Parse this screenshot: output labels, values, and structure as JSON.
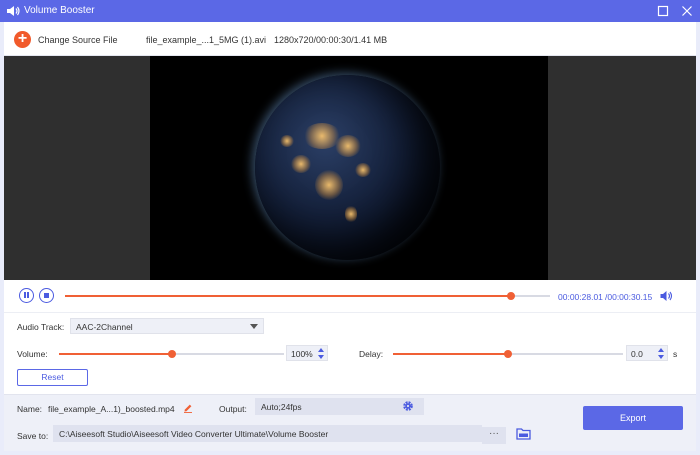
{
  "window": {
    "title": "Volume Booster",
    "accent_color": "#5b68e6",
    "progress_color": "#f06035",
    "icons": [
      "volume-icon",
      "maximize-icon",
      "close-icon"
    ]
  },
  "source": {
    "change_label": "Change Source File",
    "file_name": "file_example_...1_5MG (1).avi",
    "file_info": "1280x720/00:00:30/1.41 MB"
  },
  "player": {
    "current_time": "00:00:28.01",
    "total_time": "/00:00:30.15",
    "progress_fraction": 0.92,
    "icons": [
      "pause-icon",
      "stop-icon",
      "speaker-icon"
    ]
  },
  "audio": {
    "track_label": "Audio Track:",
    "track_value": "AAC-2Channel",
    "volume_label": "Volume:",
    "volume_value": "100%",
    "volume_fraction": 0.5,
    "delay_label": "Delay:",
    "delay_value": "0.0",
    "delay_unit": "s",
    "delay_fraction": 0.5,
    "reset_label": "Reset"
  },
  "output": {
    "name_label": "Name:",
    "name_value": "file_example_A...1)_boosted.mp4",
    "output_label": "Output:",
    "output_value": "Auto;24fps",
    "save_label": "Save to:",
    "save_path": "C:\\Aiseesoft Studio\\Aiseesoft Video Converter Ultimate\\Volume Booster",
    "more_label": "···",
    "export_label": "Export",
    "icons": [
      "edit-icon",
      "gear-icon",
      "folder-icon"
    ]
  }
}
